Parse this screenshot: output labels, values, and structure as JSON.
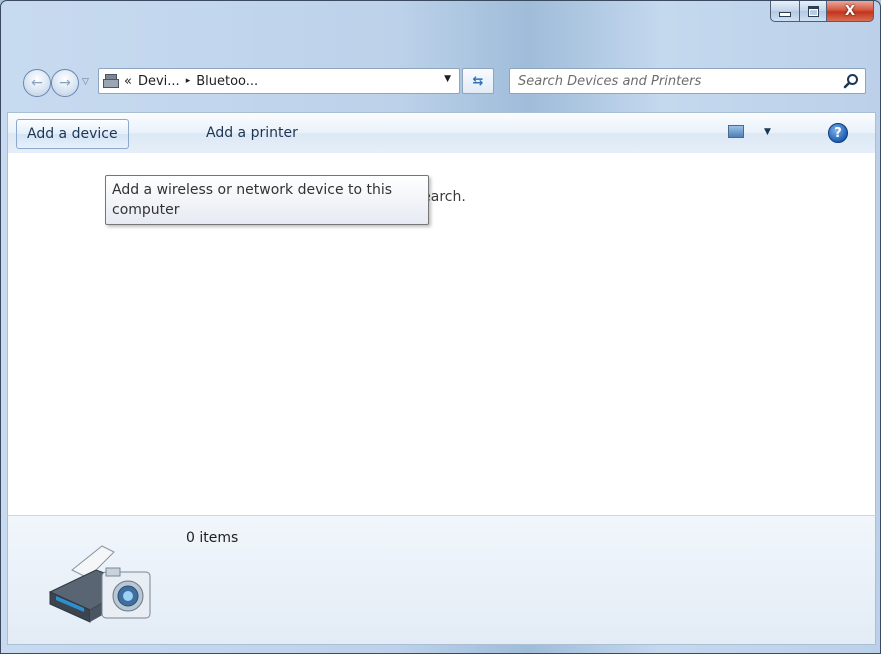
{
  "window": {
    "caption": {
      "minimize": "–",
      "maximize": "□",
      "close": "X"
    }
  },
  "nav": {
    "address_prefix": "«",
    "crumbs": [
      "Devi...",
      "Bluetoo..."
    ],
    "separator": "▸",
    "search_placeholder": "Search Devices and Printers"
  },
  "commands": {
    "add_device": "Add a device",
    "add_printer": "Add a printer"
  },
  "content": {
    "empty_message_visible": "hatch your search.",
    "tooltip": "Add a wireless or network device to this computer"
  },
  "details": {
    "items": "0 items"
  },
  "icons": [
    "back-arrow-icon",
    "forward-arrow-icon",
    "devices-printers-icon",
    "refresh-icon",
    "search-icon",
    "view-icon",
    "help-icon",
    "device-printer-camera-icon"
  ],
  "colors": {
    "accent": "#2f6fb4",
    "close": "#c2341c",
    "frame": "#bdd2ea"
  }
}
